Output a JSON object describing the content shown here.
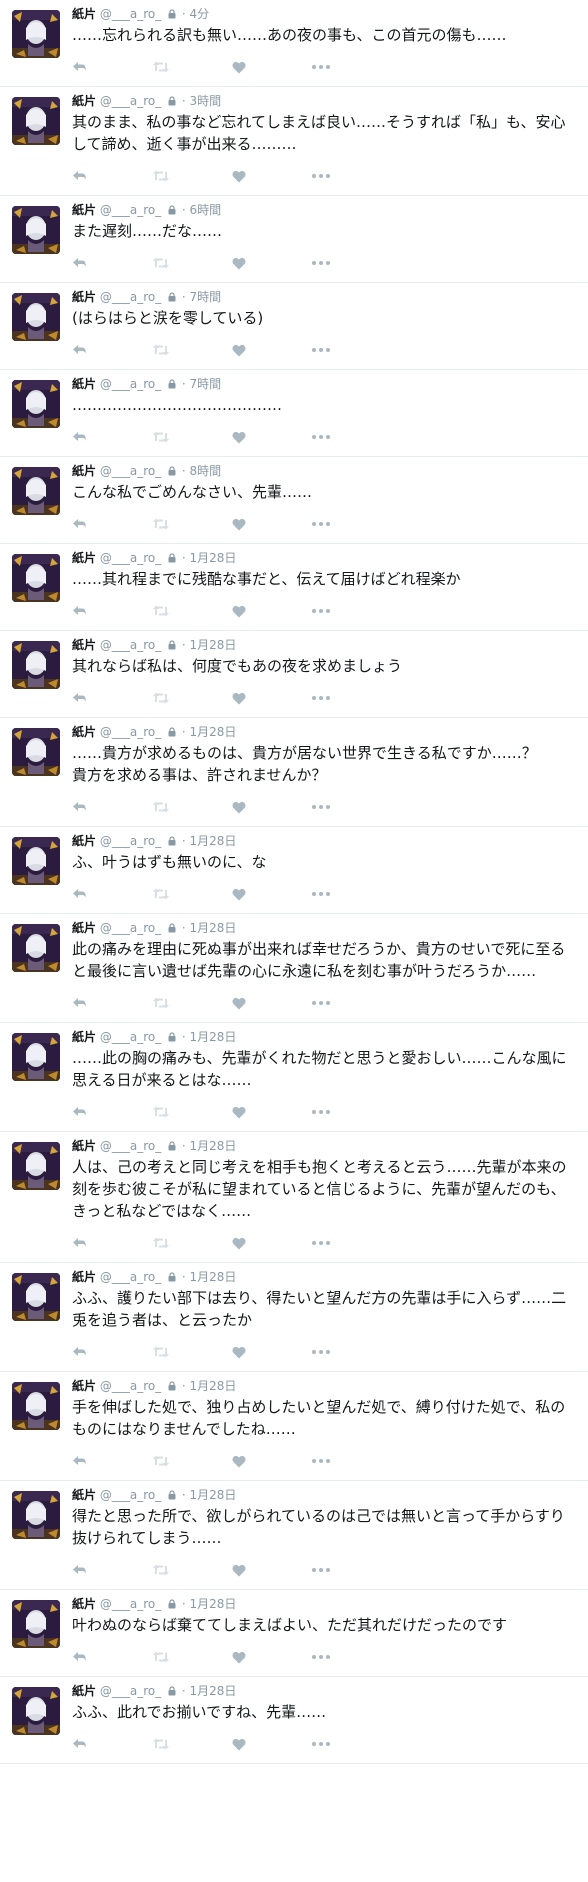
{
  "tweets": [
    {
      "name": "紙片",
      "handle": "@___a_ro_",
      "time": "4分",
      "text": "……忘れられる訳も無い……あの夜の事も、この首元の傷も……"
    },
    {
      "name": "紙片",
      "handle": "@___a_ro_",
      "time": "3時間",
      "text": "其のまま、私の事など忘れてしまえば良い……そうすれば「私」も、安心して諦め、逝く事が出来る………"
    },
    {
      "name": "紙片",
      "handle": "@___a_ro_",
      "time": "6時間",
      "text": "また遅刻……だな……"
    },
    {
      "name": "紙片",
      "handle": "@___a_ro_",
      "time": "7時間",
      "text": "(はらはらと涙を零している)"
    },
    {
      "name": "紙片",
      "handle": "@___a_ro_",
      "time": "7時間",
      "text": "……………………………………"
    },
    {
      "name": "紙片",
      "handle": "@___a_ro_",
      "time": "8時間",
      "text": "こんな私でごめんなさい、先輩……"
    },
    {
      "name": "紙片",
      "handle": "@___a_ro_",
      "time": "1月28日",
      "text": "……其れ程までに残酷な事だと、伝えて届けばどれ程楽か"
    },
    {
      "name": "紙片",
      "handle": "@___a_ro_",
      "time": "1月28日",
      "text": "其れならば私は、何度でもあの夜を求めましょう"
    },
    {
      "name": "紙片",
      "handle": "@___a_ro_",
      "time": "1月28日",
      "text": "……貴方が求めるものは、貴方が居ない世界で生きる私ですか……？\n貴方を求める事は、許されませんか？"
    },
    {
      "name": "紙片",
      "handle": "@___a_ro_",
      "time": "1月28日",
      "text": "ふ、叶うはずも無いのに、な"
    },
    {
      "name": "紙片",
      "handle": "@___a_ro_",
      "time": "1月28日",
      "text": "此の痛みを理由に死ぬ事が出来れば幸せだろうか、貴方のせいで死に至ると最後に言い遺せば先輩の心に永遠に私を刻む事が叶うだろうか……"
    },
    {
      "name": "紙片",
      "handle": "@___a_ro_",
      "time": "1月28日",
      "text": "……此の胸の痛みも、先輩がくれた物だと思うと愛おしい……こんな風に思える日が来るとはな……"
    },
    {
      "name": "紙片",
      "handle": "@___a_ro_",
      "time": "1月28日",
      "text": "人は、己の考えと同じ考えを相手も抱くと考えると云う……先輩が本来の刻を歩む彼こそが私に望まれていると信じるように、先輩が望んだのも、きっと私などではなく……"
    },
    {
      "name": "紙片",
      "handle": "@___a_ro_",
      "time": "1月28日",
      "text": "ふふ、護りたい部下は去り、得たいと望んだ方の先輩は手に入らず……二兎を追う者は、と云ったか"
    },
    {
      "name": "紙片",
      "handle": "@___a_ro_",
      "time": "1月28日",
      "text": "手を伸ばした処で、独り占めしたいと望んだ処で、縛り付けた処で、私のものにはなりませんでしたね……"
    },
    {
      "name": "紙片",
      "handle": "@___a_ro_",
      "time": "1月28日",
      "text": "得たと思った所で、欲しがられているのは己では無いと言って手からすり抜けられてしまう……"
    },
    {
      "name": "紙片",
      "handle": "@___a_ro_",
      "time": "1月28日",
      "text": "叶わぬのならば棄ててしまえばよい、ただ其れだけだったのです"
    },
    {
      "name": "紙片",
      "handle": "@___a_ro_",
      "time": "1月28日",
      "text": "ふふ、此れでお揃いですね、先輩……"
    }
  ],
  "separator": "·",
  "icons": {
    "lock": "lock-icon",
    "reply": "reply-icon",
    "retweet": "retweet-icon",
    "like": "heart-icon",
    "more": "more-icon"
  },
  "colors": {
    "icon": "#aab8c2",
    "meta": "#8899a6",
    "border": "#e6ecf0",
    "text": "#14171a"
  }
}
